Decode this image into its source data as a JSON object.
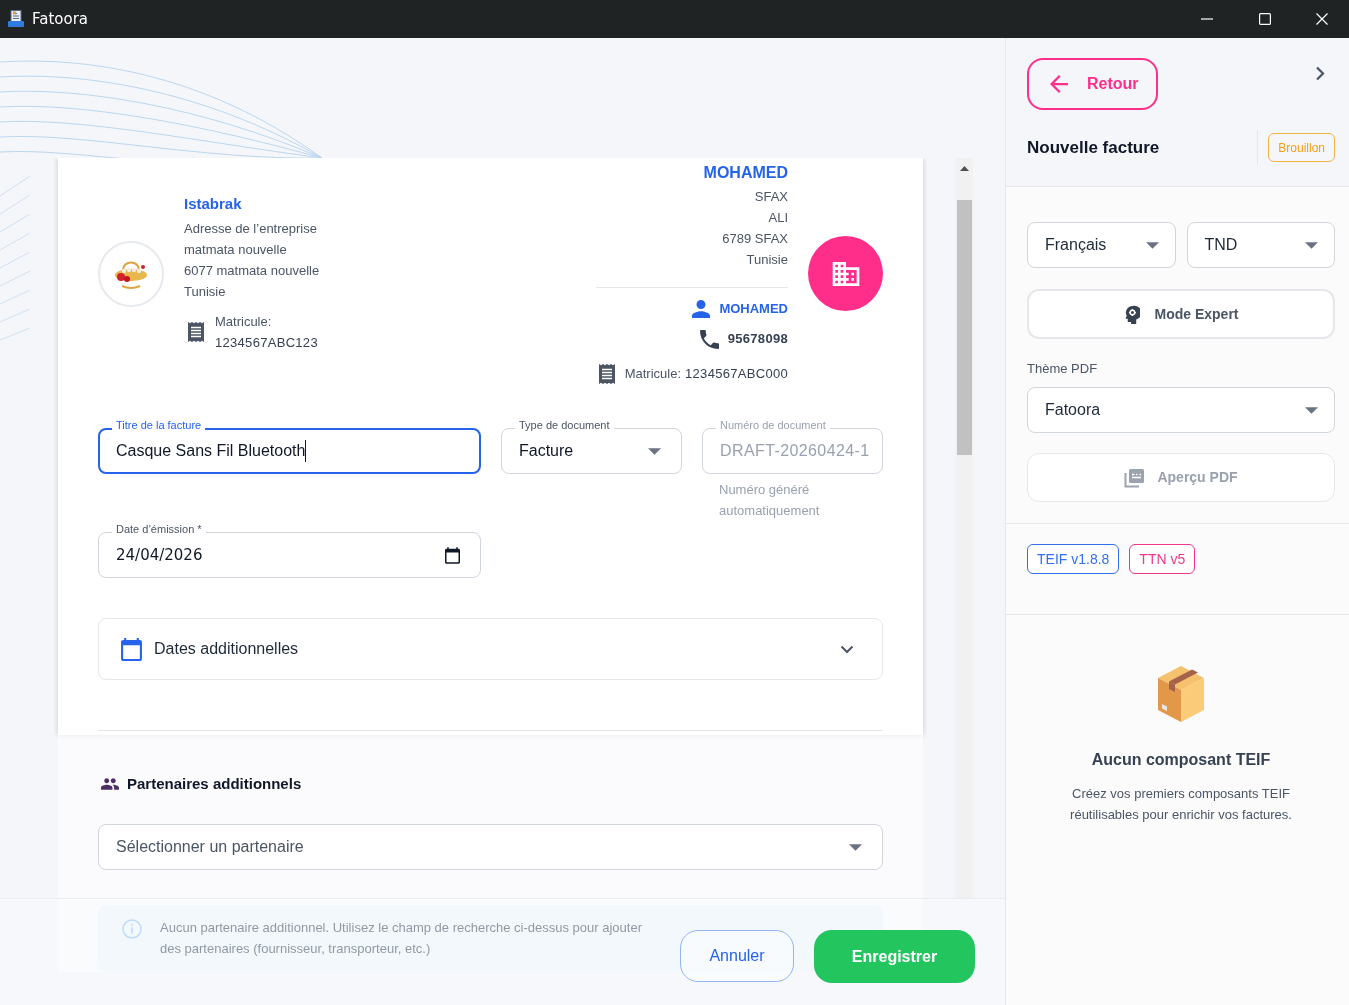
{
  "window": {
    "title": "Fatoora"
  },
  "company": {
    "name": "Istabrak",
    "address_lines": [
      "Adresse de l’entreprise",
      "matmata nouvelle",
      "6077 matmata nouvelle",
      "Tunisie"
    ],
    "matricule_label": "Matricule:",
    "matricule": "1234567ABC123"
  },
  "client": {
    "name": "MOHAMED",
    "address_lines": [
      "SFAX",
      "ALI",
      "6789 SFAX",
      "Tunisie"
    ],
    "contact_name": "MOHAMED",
    "phone": "95678098",
    "matricule_label": "Matricule:",
    "matricule": "1234567ABC000"
  },
  "invoice_fields": [
    {
      "kind": "text",
      "label": "Titre de la facture",
      "value": "Casque Sans Fil Bluetooth",
      "focused": true,
      "disabled": false
    },
    {
      "kind": "select",
      "label": "Type de document",
      "value": "Facture",
      "focused": false,
      "disabled": false
    },
    {
      "kind": "text",
      "label": "Numéro de document",
      "value": "DRAFT-20260424-1",
      "focused": false,
      "disabled": true,
      "helper": "Numéro généré automatiquement"
    },
    {
      "kind": "date",
      "label": "Date d’émission *",
      "value": "24/04/2026",
      "focused": false,
      "disabled": false
    }
  ],
  "accordion": {
    "label": "Dates additionnelles",
    "expanded": false
  },
  "partners": {
    "title": "Partenaires additionnels",
    "placeholder": "Sélectionner un partenaire",
    "empty_message": "Aucun partenaire additionnel. Utilisez le champ de recherche ci-dessus pour ajouter des partenaires (fournisseur, transporteur, etc.)"
  },
  "actions": [
    {
      "label": "Annuler",
      "kind": "secondary"
    },
    {
      "label": "Enregistrer",
      "kind": "primary"
    }
  ],
  "sidebar": {
    "back_button": "Retour",
    "title": "Nouvelle facture",
    "status_badge": "Brouillon",
    "language": "Français",
    "currency": "TND",
    "expert_button": "Mode Expert",
    "pdf_theme": {
      "label": "Thème PDF",
      "value": "Fatoora"
    },
    "preview_button": {
      "label": "Aperçu PDF",
      "disabled": true
    },
    "badges": [
      {
        "label": "TEIF v1.8.8",
        "color": "#2f6fec"
      },
      {
        "label": "TTN v5",
        "color": "#f0388a"
      }
    ],
    "empty_state": {
      "title": "Aucun composant TEIF",
      "text": "Créez vos premiers composants TEIF réutilisables pour enrichir vos factures."
    }
  }
}
